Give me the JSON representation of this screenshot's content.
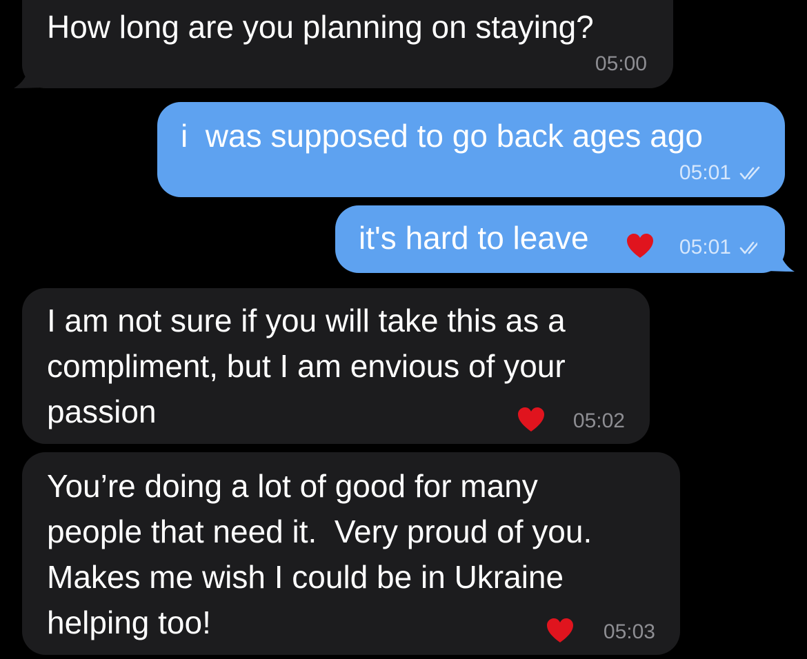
{
  "messages": [
    {
      "direction": "incoming",
      "lines": [
        "How long are you planning on staying?"
      ],
      "time": "05:00",
      "reaction": "",
      "read_receipt": ""
    },
    {
      "direction": "outgoing",
      "lines": [
        "i  was supposed to go back ages ago"
      ],
      "time": "05:01",
      "reaction": "",
      "read_receipt": "double-check-icon"
    },
    {
      "direction": "outgoing",
      "lines": [
        "it's hard to leave"
      ],
      "time": "05:01",
      "reaction": "red-heart",
      "read_receipt": "double-check-icon"
    },
    {
      "direction": "incoming",
      "lines": [
        "I am not sure if you will take this as a",
        "compliment, but I am envious of your",
        "passion"
      ],
      "time": "05:02",
      "reaction": "red-heart",
      "read_receipt": ""
    },
    {
      "direction": "incoming",
      "lines": [
        "You’re doing a lot of good for many",
        "people that need it.  Very proud of you.",
        "Makes me wish I could be in Ukraine",
        "helping too!"
      ],
      "time": "05:03",
      "reaction": "red-heart",
      "read_receipt": ""
    }
  ],
  "colors": {
    "background": "#000000",
    "incoming_bubble": "#1c1c1e",
    "outgoing_bubble": "#5ea2f0",
    "text": "#ffffff",
    "incoming_time": "#8e8e93",
    "outgoing_time": "#d6e7fc",
    "heart": "#e0141e"
  }
}
